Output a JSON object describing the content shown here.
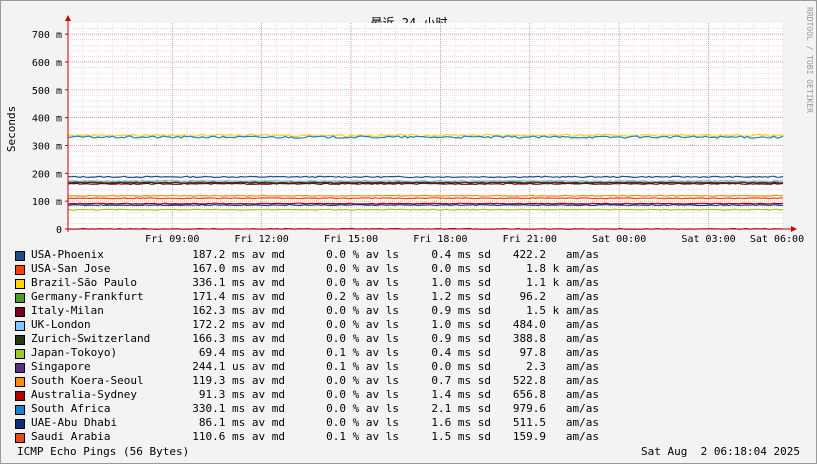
{
  "chart_data": {
    "type": "line",
    "title": "最近 24 小时",
    "ylabel": "Seconds",
    "side_label": "RRDTOOL / TOBI OETIKER",
    "yticks": [
      {
        "v": 0,
        "label": "0"
      },
      {
        "v": 0.1,
        "label": "100 m"
      },
      {
        "v": 0.2,
        "label": "200 m"
      },
      {
        "v": 0.3,
        "label": "300 m"
      },
      {
        "v": 0.4,
        "label": "400 m"
      },
      {
        "v": 0.5,
        "label": "500 m"
      },
      {
        "v": 0.6,
        "label": "600 m"
      },
      {
        "v": 0.7,
        "label": "700 m"
      }
    ],
    "ylim": [
      0,
      0.74
    ],
    "xlim_hours": [
      0,
      24
    ],
    "xticks": [
      {
        "h": 3.5,
        "label": "Fri 09:00"
      },
      {
        "h": 6.5,
        "label": "Fri 12:00"
      },
      {
        "h": 9.5,
        "label": "Fri 15:00"
      },
      {
        "h": 12.5,
        "label": "Fri 18:00"
      },
      {
        "h": 15.5,
        "label": "Fri 21:00"
      },
      {
        "h": 18.5,
        "label": "Sat 00:00"
      },
      {
        "h": 21.5,
        "label": "Sat 03:00"
      },
      {
        "h": 24.5,
        "label": "Sat 06:00"
      }
    ],
    "series": [
      {
        "name": "USA-Phoenix",
        "color": "#1f4e8c",
        "avg": 0.1872,
        "avg_t": "187.2 ms av md",
        "loss": "0.0 % av ls",
        "sd": "0.4 ms sd",
        "ams": "422.2   am/as"
      },
      {
        "name": "USA-San Jose",
        "color": "#ff4000",
        "avg": 0.167,
        "avg_t": "167.0 ms av md",
        "loss": "0.0 % av ls",
        "sd": "0.0 ms sd",
        "ams": "1.8 k am/as"
      },
      {
        "name": "Brazil-São Paulo",
        "color": "#ffd700",
        "avg": 0.3361,
        "avg_t": "336.1 ms av md",
        "loss": "0.0 % av ls",
        "sd": "1.0 ms sd",
        "ams": "1.1 k am/as"
      },
      {
        "name": "Germany-Frankfurt",
        "color": "#4d9a26",
        "avg": 0.1714,
        "avg_t": "171.4 ms av md",
        "loss": "0.2 % av ls",
        "sd": "1.2 ms sd",
        "ams": "96.2   am/as"
      },
      {
        "name": "Italy-Milan",
        "color": "#7a0020",
        "avg": 0.1623,
        "avg_t": "162.3 ms av md",
        "loss": "0.0 % av ls",
        "sd": "0.9 ms sd",
        "ams": "1.5 k am/as"
      },
      {
        "name": "UK-London",
        "color": "#80c8ff",
        "avg": 0.1722,
        "avg_t": "172.2 ms av md",
        "loss": "0.0 % av ls",
        "sd": "1.0 ms sd",
        "ams": "484.0   am/as"
      },
      {
        "name": "Zurich-Switzerland",
        "color": "#2a3a10",
        "avg": 0.1663,
        "avg_t": "166.3 ms av md",
        "loss": "0.0 % av ls",
        "sd": "0.9 ms sd",
        "ams": "388.8   am/as"
      },
      {
        "name": "Japan-Tokoyo)",
        "color": "#a0c828",
        "avg": 0.0694,
        "avg_t": "69.4 ms av md",
        "loss": "0.1 % av ls",
        "sd": "0.4 ms sd",
        "ams": "97.8   am/as"
      },
      {
        "name": "Singapore",
        "color": "#5a2d82",
        "avg": 0.000244,
        "avg_t": "244.1 us av md",
        "loss": "0.1 % av ls",
        "sd": "0.0 ms sd",
        "ams": "2.3   am/as"
      },
      {
        "name": "South Koera-Seoul",
        "color": "#ff8c00",
        "avg": 0.1193,
        "avg_t": "119.3 ms av md",
        "loss": "0.0 % av ls",
        "sd": "0.7 ms sd",
        "ams": "522.8   am/as"
      },
      {
        "name": "Australia-Sydney",
        "color": "#b00000",
        "avg": 0.0913,
        "avg_t": "91.3 ms av md",
        "loss": "0.0 % av ls",
        "sd": "1.4 ms sd",
        "ams": "656.8   am/as"
      },
      {
        "name": "South Africa",
        "color": "#1e82c8",
        "avg": 0.3301,
        "avg_t": "330.1 ms av md",
        "loss": "0.0 % av ls",
        "sd": "2.1 ms sd",
        "ams": "979.6   am/as"
      },
      {
        "name": "UAE-Abu Dhabi",
        "color": "#0a3278",
        "avg": 0.0861,
        "avg_t": "86.1 ms av md",
        "loss": "0.0 % av ls",
        "sd": "1.6 ms sd",
        "ams": "511.5   am/as"
      },
      {
        "name": "Saudi Arabia",
        "color": "#e8461e",
        "avg": 0.1106,
        "avg_t": "110.6 ms av md",
        "loss": "0.1 % av ls",
        "sd": "1.5 ms sd",
        "ams": "159.9   am/as"
      }
    ]
  },
  "footer": {
    "left": "ICMP Echo Pings (56 Bytes)",
    "right": "Sat Aug  2 06:18:04 2025"
  }
}
